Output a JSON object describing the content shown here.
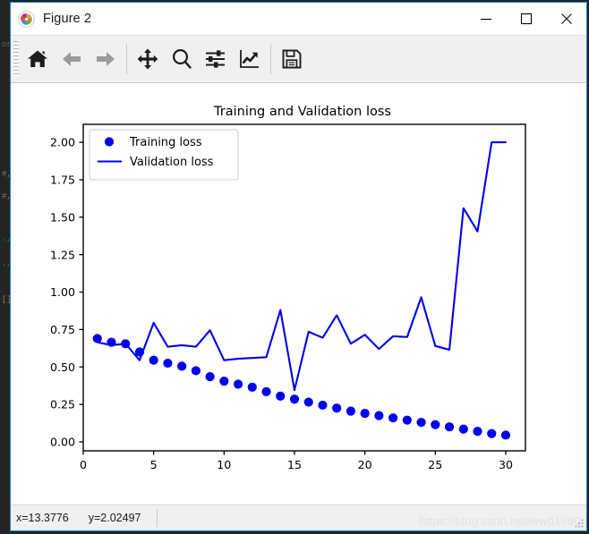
{
  "window": {
    "title": "Figure 2",
    "icon": "matplotlib-logo-icon",
    "border_color": "#1884d8",
    "controls": [
      {
        "name": "minimize",
        "glyph": "─"
      },
      {
        "name": "maximize",
        "glyph": "□"
      },
      {
        "name": "close",
        "glyph": "✕"
      }
    ]
  },
  "toolbar": {
    "buttons": [
      {
        "name": "home-icon",
        "tooltip": "Reset original view",
        "enabled": true
      },
      {
        "name": "back-arrow-icon",
        "tooltip": "Back to previous view",
        "enabled": false
      },
      {
        "name": "forward-arrow-icon",
        "tooltip": "Forward to next view",
        "enabled": false
      },
      {
        "name": "pan-move-icon",
        "tooltip": "Pan axes with left mouse, zoom with right",
        "enabled": true
      },
      {
        "name": "zoom-magnifier-icon",
        "tooltip": "Zoom to rectangle",
        "enabled": true
      },
      {
        "name": "configure-subplots-icon",
        "tooltip": "Configure subplots",
        "enabled": true
      },
      {
        "name": "edit-axis-curve-icon",
        "tooltip": "Edit axis, curve and image parameters",
        "enabled": true
      },
      {
        "name": "save-floppy-icon",
        "tooltip": "Save the figure",
        "enabled": true
      }
    ]
  },
  "status": {
    "x_readout": "x=13.3776",
    "y_readout": "y=2.02497",
    "watermark": "https://blog.csdn.net/wwb1990"
  },
  "chart_data": {
    "type": "scatter",
    "title": "Training and Validation loss",
    "xlabel": "",
    "ylabel": "",
    "grid": false,
    "legend_position": "upper left",
    "xlim": [
      0.0,
      31.4
    ],
    "ylim": [
      -0.06,
      2.12
    ],
    "xticks": [
      0,
      5,
      10,
      15,
      20,
      25,
      30
    ],
    "xtick_labels": [
      "0",
      "5",
      "10",
      "15",
      "20",
      "25",
      "30"
    ],
    "yticks": [
      0.0,
      0.25,
      0.5,
      0.75,
      1.0,
      1.25,
      1.5,
      1.75,
      2.0
    ],
    "ytick_labels": [
      "0.00",
      "0.25",
      "0.50",
      "0.75",
      "1.00",
      "1.25",
      "1.50",
      "1.75",
      "2.00"
    ],
    "x": [
      1,
      2,
      3,
      4,
      5,
      6,
      7,
      8,
      9,
      10,
      11,
      12,
      13,
      14,
      15,
      16,
      17,
      18,
      19,
      20,
      21,
      22,
      23,
      24,
      25,
      26,
      27,
      28,
      29,
      30
    ],
    "series": [
      {
        "name": "Training loss",
        "style": "markers",
        "marker": "o",
        "color": "#0000ee",
        "values": [
          0.69,
          0.665,
          0.655,
          0.6,
          0.545,
          0.525,
          0.505,
          0.475,
          0.435,
          0.405,
          0.385,
          0.365,
          0.335,
          0.305,
          0.285,
          0.265,
          0.245,
          0.225,
          0.205,
          0.19,
          0.175,
          0.16,
          0.145,
          0.13,
          0.115,
          0.1,
          0.085,
          0.07,
          0.055,
          0.045
        ]
      },
      {
        "name": "Validation loss",
        "style": "line",
        "color": "#0000ee",
        "values": [
          0.665,
          0.645,
          0.655,
          0.545,
          0.795,
          0.635,
          0.645,
          0.635,
          0.745,
          0.545,
          0.555,
          0.56,
          0.565,
          0.88,
          0.345,
          0.735,
          0.695,
          0.845,
          0.655,
          0.715,
          0.62,
          0.705,
          0.7,
          0.965,
          0.64,
          0.615,
          1.56,
          1.405,
          2.0,
          2.0
        ]
      }
    ],
    "legend_entries": [
      {
        "label": "Training loss",
        "marker": "dot",
        "color": "#0000ee"
      },
      {
        "label": "Validation loss",
        "marker": "line",
        "color": "#0000ee"
      }
    ]
  }
}
